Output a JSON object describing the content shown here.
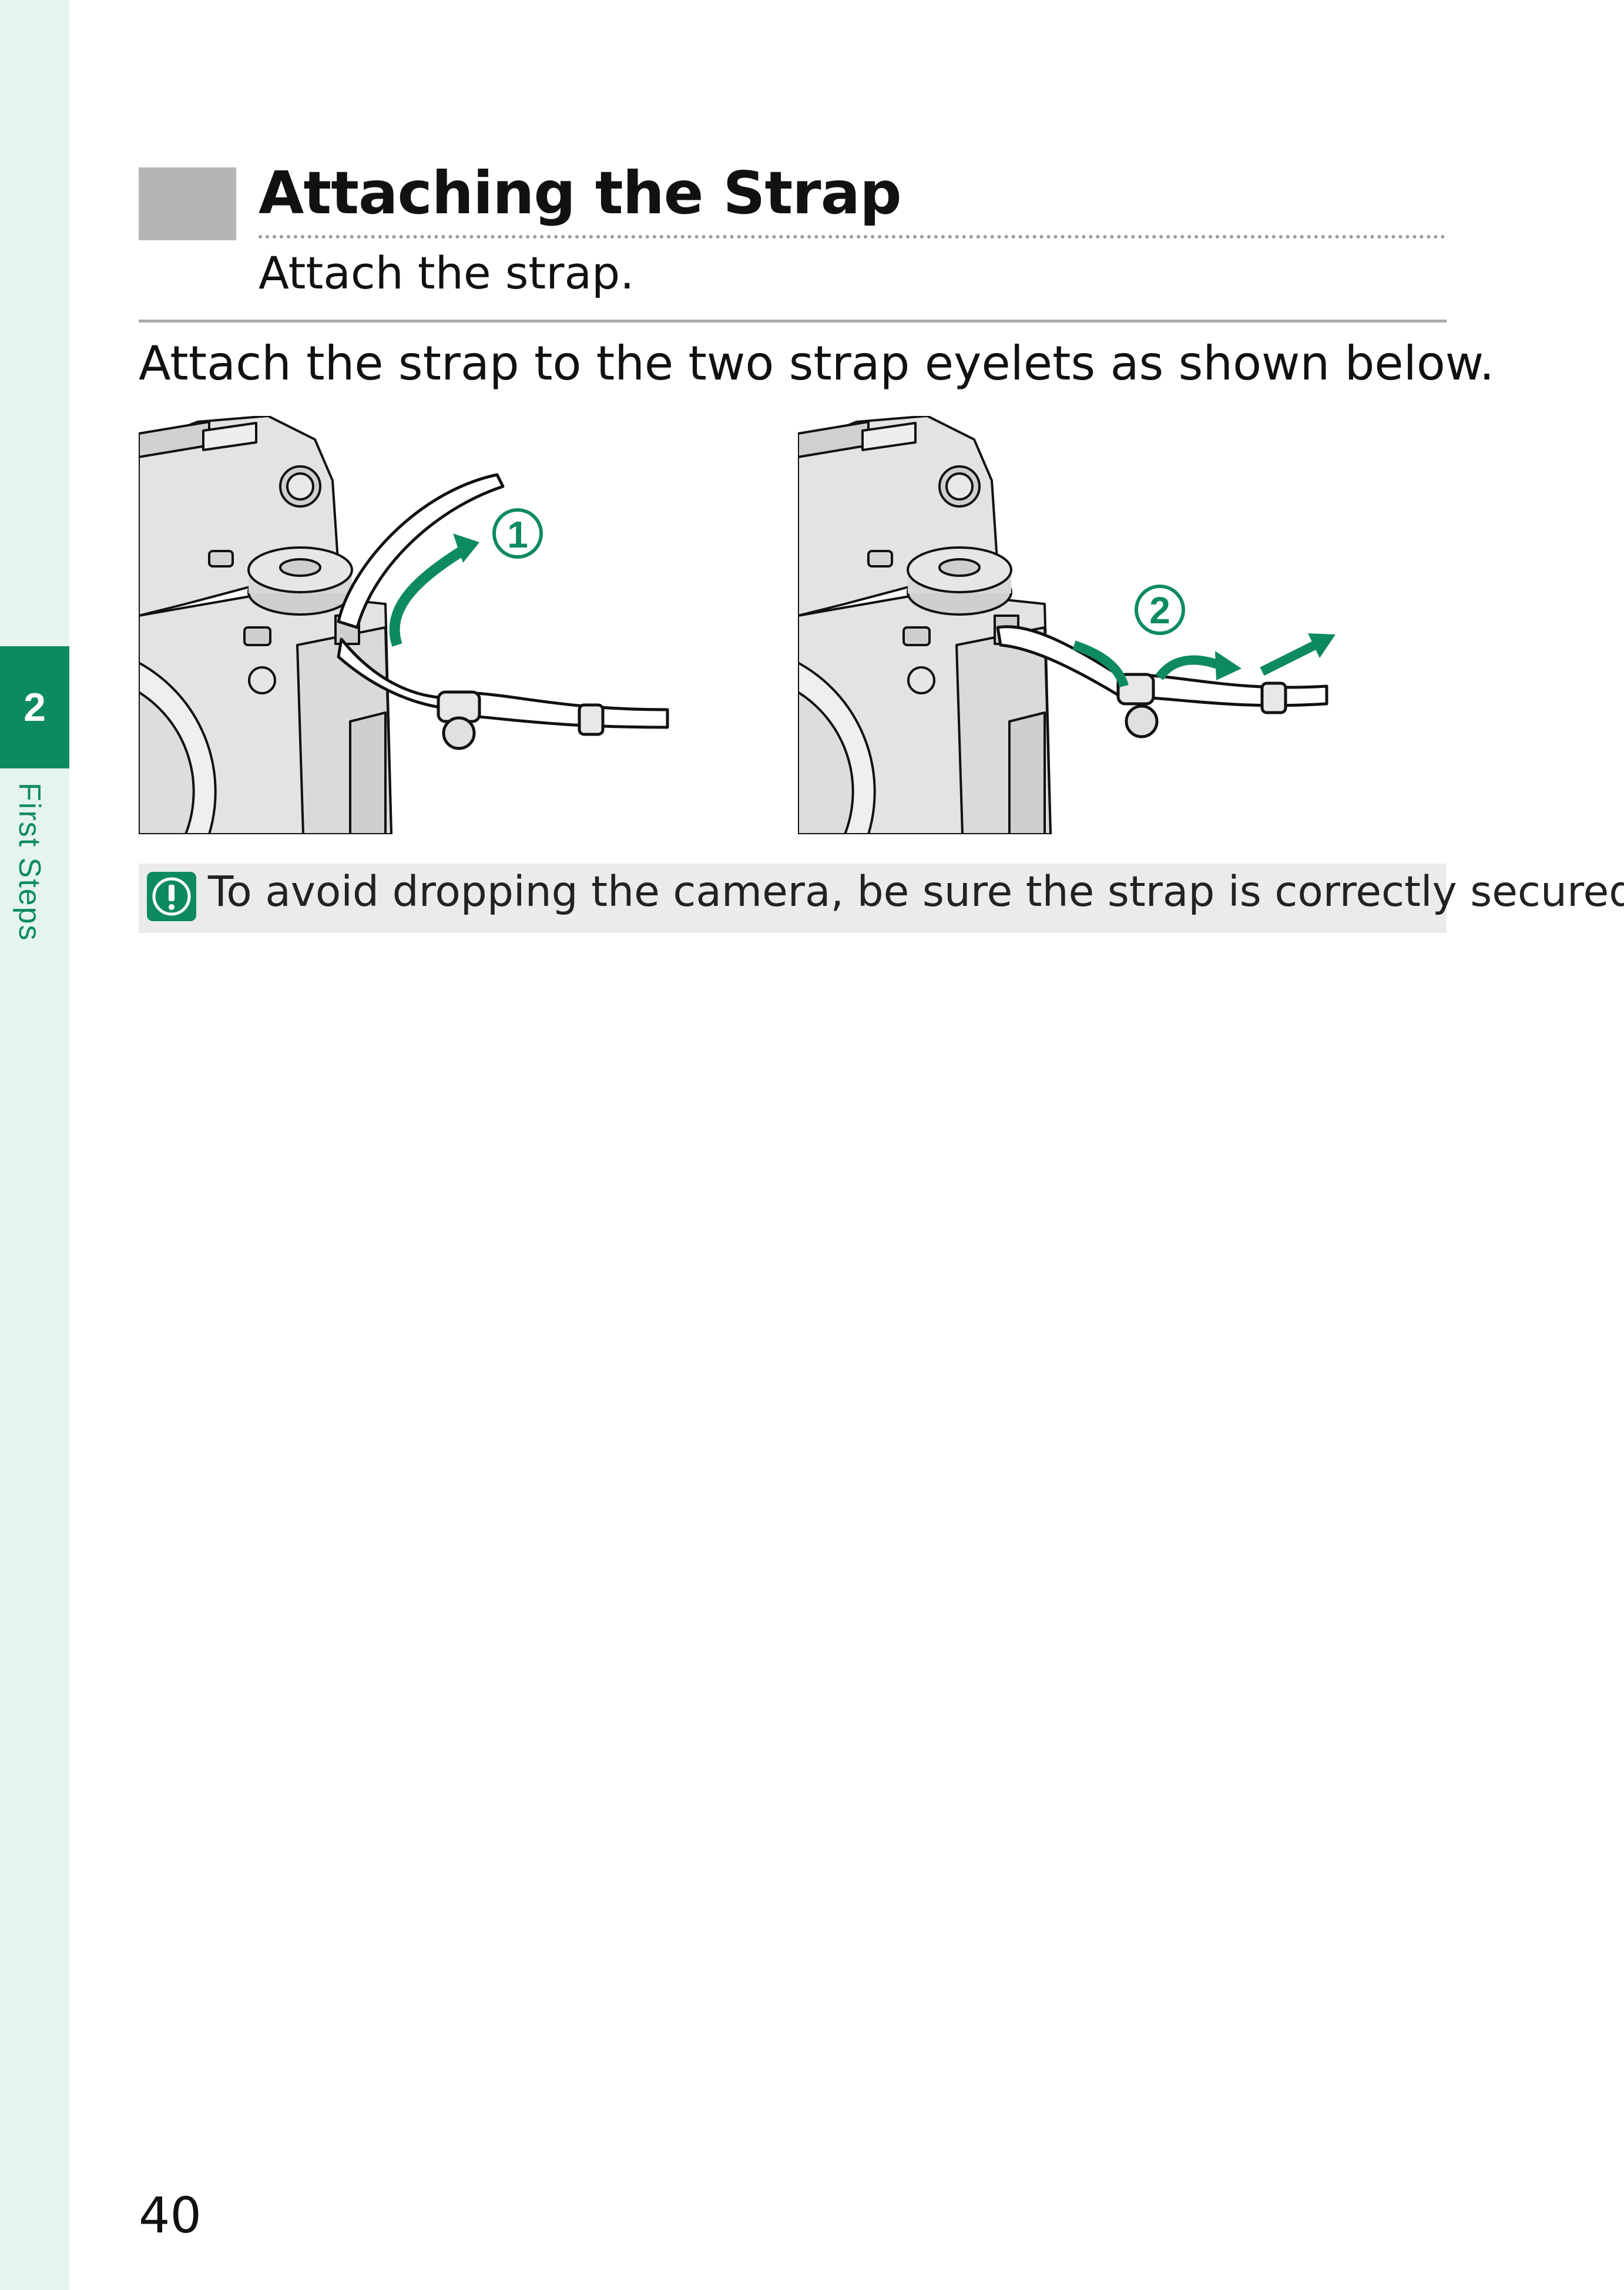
{
  "sidebar": {
    "chapter_number": "2",
    "chapter_label": "First Steps",
    "accent_color": "#0e8a63",
    "strip_color": "#e5f4ef"
  },
  "section": {
    "title": "Attaching the Strap",
    "subtitle": "Attach the strap."
  },
  "body": {
    "lead": "Attach the strap to the two strap eyelets as shown below."
  },
  "figures": [
    {
      "step_label": "1",
      "icon": "camera-strap-step-1-illustration"
    },
    {
      "step_label": "2",
      "icon": "camera-strap-step-2-illustration"
    }
  ],
  "note": {
    "icon": "caution-icon",
    "text": "To avoid dropping the camera, be sure the strap is correctly secured."
  },
  "footer": {
    "page_number": "40"
  }
}
